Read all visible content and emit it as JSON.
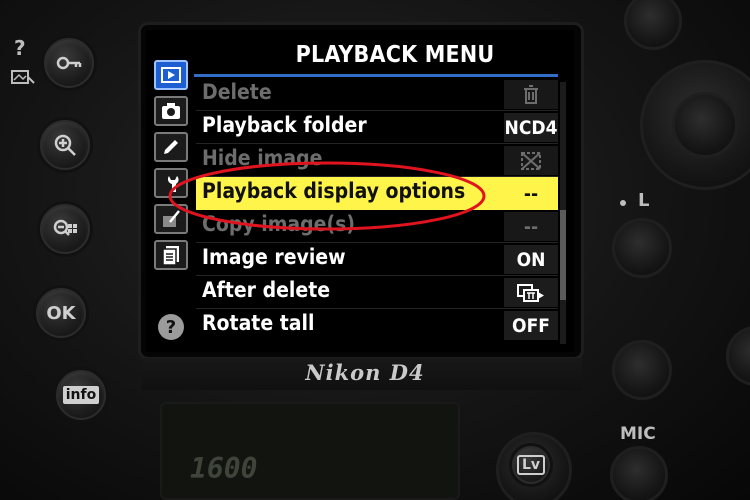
{
  "screen": {
    "title": "PLAYBACK MENU",
    "tabs": [
      {
        "name": "playback-tab",
        "active": true
      },
      {
        "name": "shooting-tab",
        "active": false
      },
      {
        "name": "custom-settings-tab",
        "active": false
      },
      {
        "name": "setup-tab",
        "active": false
      },
      {
        "name": "retouch-tab",
        "active": false
      },
      {
        "name": "my-menu-tab",
        "active": false
      }
    ],
    "help_label": "?",
    "items": [
      {
        "label": "Delete",
        "value": "",
        "value_icon": "trash-icon",
        "state": "disabled"
      },
      {
        "label": "Playback folder",
        "value": "NCD4",
        "state": "normal"
      },
      {
        "label": "Hide image",
        "value": "",
        "value_icon": "hide-image-icon",
        "state": "disabled"
      },
      {
        "label": "Playback display options",
        "value": "--",
        "state": "selected"
      },
      {
        "label": "Copy image(s)",
        "value": "--",
        "state": "disabled"
      },
      {
        "label": "Image review",
        "value": "ON",
        "state": "normal"
      },
      {
        "label": "After delete",
        "value": "",
        "value_icon": "after-delete-icon",
        "state": "normal"
      },
      {
        "label": "Rotate tall",
        "value": "OFF",
        "state": "normal"
      }
    ],
    "annotation_color": "#e0141e",
    "highlight_color": "#fff54a",
    "active_tab_color": "#1d5fd0"
  },
  "camera": {
    "brand": "Nikon D4",
    "left_buttons": {
      "help_protect_label": "?",
      "ok_label": "OK",
      "info_label": "info"
    },
    "right_labels": {
      "lock_label": "L",
      "mic_label": "MIC",
      "lv_label": "Lv"
    },
    "lower_lcd_readout": "1600"
  }
}
